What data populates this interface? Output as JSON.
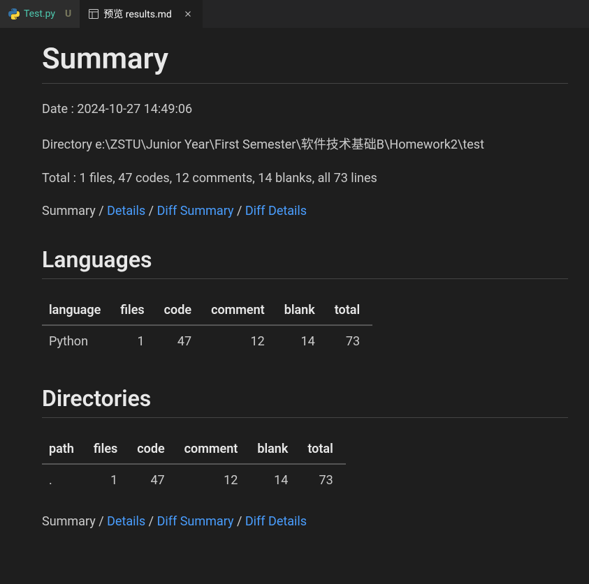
{
  "tabs": {
    "inactive": {
      "name": "Test.py",
      "modified": "U"
    },
    "active": {
      "name": "预览 results.md"
    }
  },
  "heading": "Summary",
  "date_line": "Date : 2024-10-27 14:49:06",
  "directory_line": "Directory e:\\ZSTU\\Junior Year\\First Semester\\软件技术基础B\\Homework2\\test",
  "total_line": "Total : 1 files, 47 codes, 12 comments, 14 blanks, all 73 lines",
  "nav": {
    "summary": "Summary",
    "sep": " / ",
    "details": "Details",
    "diff_summary": "Diff Summary",
    "diff_details": "Diff Details"
  },
  "languages": {
    "heading": "Languages",
    "headers": {
      "language": "language",
      "files": "files",
      "code": "code",
      "comment": "comment",
      "blank": "blank",
      "total": "total"
    },
    "row": {
      "language": "Python",
      "files": "1",
      "code": "47",
      "comment": "12",
      "blank": "14",
      "total": "73"
    }
  },
  "directories": {
    "heading": "Directories",
    "headers": {
      "path": "path",
      "files": "files",
      "code": "code",
      "comment": "comment",
      "blank": "blank",
      "total": "total"
    },
    "row": {
      "path": ".",
      "files": "1",
      "code": "47",
      "comment": "12",
      "blank": "14",
      "total": "73"
    }
  }
}
